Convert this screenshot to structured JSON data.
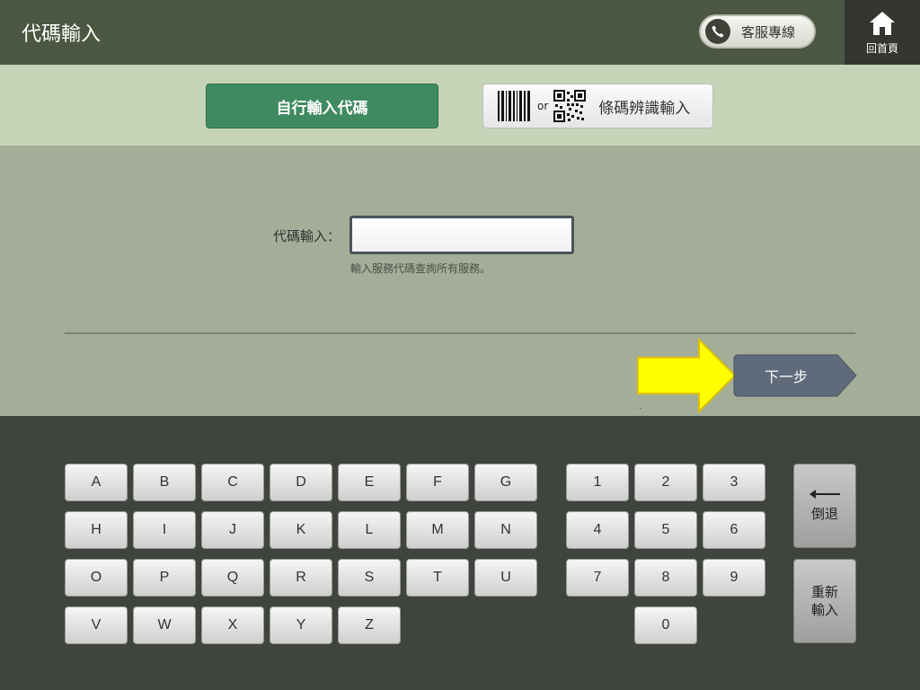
{
  "header": {
    "title": "代碼輸入",
    "service_label": "客服專線",
    "home_label": "回首頁"
  },
  "modes": {
    "manual_label": "自行輸入代碼",
    "barcode_or": "or",
    "barcode_label": "條碼辨識輸入"
  },
  "form": {
    "input_label": "代碼輸入：",
    "input_value": "",
    "hint": "輸入服務代碼查詢所有服務。"
  },
  "next_label": "下一步",
  "keyboard": {
    "letters": [
      "A",
      "B",
      "C",
      "D",
      "E",
      "F",
      "G",
      "H",
      "I",
      "J",
      "K",
      "L",
      "M",
      "N",
      "O",
      "P",
      "Q",
      "R",
      "S",
      "T",
      "U",
      "V",
      "W",
      "X",
      "Y",
      "Z"
    ],
    "digits": [
      "1",
      "2",
      "3",
      "4",
      "5",
      "6",
      "7",
      "8",
      "9",
      "0"
    ],
    "backspace_label": "倒退",
    "reset_label_line1": "重新",
    "reset_label_line2": "輸入"
  },
  "colors": {
    "header_bg": "#4b5740",
    "modebar_bg": "#c5d4b6",
    "active_mode": "#3f8a60",
    "main_bg": "#a3ad98",
    "keyboard_bg": "#3f443c",
    "next_btn": "#5f6b7b",
    "hint_arrow": "#ffff00"
  },
  "icons": {
    "phone": "phone-icon",
    "home": "home-icon",
    "barcode": "barcode-icon",
    "qrcode": "qrcode-icon",
    "backspace": "arrow-left-icon"
  }
}
